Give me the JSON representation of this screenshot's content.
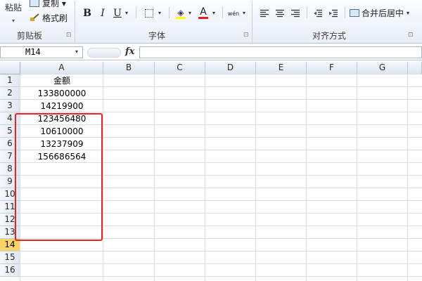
{
  "ribbon": {
    "clipboard": {
      "paste_label": "粘贴",
      "copy_label": "复制 ▾",
      "format_painter_label": "格式刷",
      "group_label": "剪贴板"
    },
    "font": {
      "bold": "B",
      "italic": "I",
      "underline": "U",
      "font_color_glyph": "A",
      "phonetic_glyph": "wén",
      "group_label": "字体"
    },
    "alignment": {
      "merge_label": "合并后居中",
      "group_label": "对齐方式"
    }
  },
  "formula_bar": {
    "name_box": "M14",
    "fx_label": "fx"
  },
  "grid": {
    "columns": [
      "A",
      "B",
      "C",
      "D",
      "E",
      "F",
      "G"
    ],
    "rows": [
      "1",
      "2",
      "3",
      "4",
      "5",
      "6",
      "7",
      "8",
      "9",
      "10",
      "11",
      "12",
      "13",
      "14",
      "15",
      "16"
    ],
    "selected_row": "14",
    "column_a_values": [
      "金额",
      "133800000",
      "14219900",
      "123456480",
      "10610000",
      "13237909",
      "156686564"
    ]
  },
  "colors": {
    "highlight_border": "#e8242b",
    "selected_header": "#f8d468",
    "font_color_bar": "#e02020"
  }
}
